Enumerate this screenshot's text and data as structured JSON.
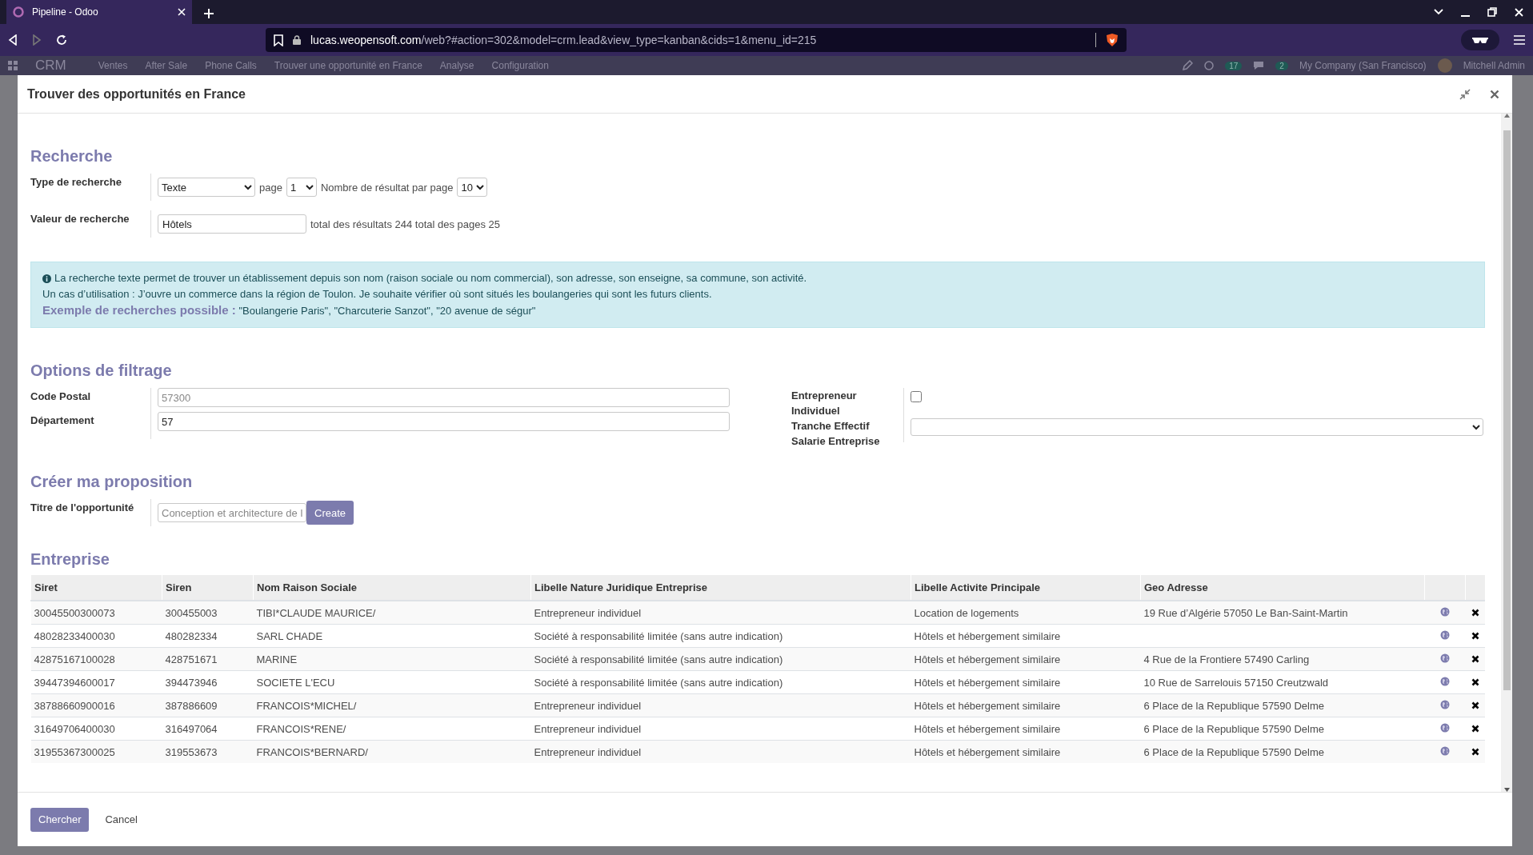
{
  "browser": {
    "tab_title": "Pipeline - Odoo",
    "url_host": "lucas.weopensoft.com",
    "url_path": "/web?#action=302&model=crm.lead&view_type=kanban&cids=1&menu_id=215"
  },
  "app_nav": {
    "app": "CRM",
    "menu": [
      "Ventes",
      "After Sale",
      "Phone Calls",
      "Trouver une opportunité en France",
      "Analyse",
      "Configuration"
    ],
    "activity_count": "17",
    "message_count": "2",
    "company": "My Company (San Francisco)",
    "user": "Mitchell Admin"
  },
  "dialog": {
    "title": "Trouver des opportunités en France",
    "search": {
      "heading": "Recherche",
      "type_label": "Type de recherche",
      "type_value": "Texte",
      "page_label": "page",
      "page_value": "1",
      "per_page_label": "Nombre de résultat par page",
      "per_page_value": "10",
      "value_label": "Valeur de recherche",
      "value": "Hôtels",
      "totals": "total des résultats 244 total des pages 25"
    },
    "info": {
      "line_1": "La recherche texte permet de trouver un établissement depuis son nom (raison sociale ou nom commercial), son adresse, son enseigne, sa commune, son activité.",
      "line_2": "Un cas d’utilisation : J’ouvre un commerce dans la région de Toulon. Je souhaite vérifier où sont situés les boulangeries qui sont les futurs clients.",
      "example": "**Exemple de recherches possible :** \"Boulangerie Paris\", \"Charcuterie Sanzot\", \"20 avenue de ségur\""
    },
    "filters": {
      "heading": "Options de filtrage",
      "postal_label": "Code Postal",
      "postal_placeholder": "57300",
      "department_label": "Département",
      "department_value": "57",
      "individual_label": "Entrepreneur Individuel",
      "individual_checked": false,
      "headcount_label": "Tranche Effectif Salarie Entreprise"
    },
    "proposal": {
      "heading": "Créer ma proposition",
      "title_label": "Titre de l'opportunité",
      "title_placeholder": "Conception et architecture de l",
      "create_button": "Create"
    },
    "companies": {
      "heading": "Entreprise",
      "columns": [
        "Siret",
        "Siren",
        "Nom Raison Sociale",
        "Libelle Nature Juridique Entreprise",
        "Libelle Activite Principale",
        "Geo Adresse"
      ],
      "rows": [
        {
          "siret": "30045500300073",
          "siren": "300455003",
          "name": "TIBI*CLAUDE MAURICE/",
          "legal_form": "Entrepreneur individuel",
          "activity": "Location de logements",
          "address": "19 Rue d’Algérie 57050 Le Ban-Saint-Martin"
        },
        {
          "siret": "48028233400030",
          "siren": "480282334",
          "name": "SARL CHADE",
          "legal_form": "Société à responsabilité limitée (sans autre indication)",
          "activity": "Hôtels et hébergement similaire"
        },
        {
          "siret": "42875167100028",
          "siren": "428751671",
          "name": "MARINE",
          "legal_form": "Société à responsabilité limitée (sans autre indication)",
          "activity": "Hôtels et hébergement similaire",
          "address": "4 Rue de la Frontiere 57490 Carling"
        },
        {
          "siret": "39447394600017",
          "siren": "394473946",
          "name": "SOCIETE L'ECU",
          "legal_form": "Société à responsabilité limitée (sans autre indication)",
          "activity": "Hôtels et hébergement similaire",
          "address": "10 Rue de Sarrelouis 57150 Creutzwald"
        },
        {
          "siret": "38788660900016",
          "siren": "387886609",
          "name": "FRANCOIS*MICHEL/",
          "legal_form": "Entrepreneur individuel",
          "activity": "Hôtels et hébergement similaire",
          "address": "6 Place de la Republique 57590 Delme"
        },
        {
          "siret": "31649706400030",
          "siren": "316497064",
          "name": "FRANCOIS*RENE/",
          "legal_form": "Entrepreneur individuel",
          "activity": "Hôtels et hébergement similaire",
          "address": "6 Place de la Republique 57590 Delme"
        },
        {
          "siret": "31955367300025",
          "siren": "319553673",
          "name": "FRANCOIS*BERNARD/",
          "legal_form": "Entrepreneur individuel",
          "activity": "Hôtels et hébergement similaire",
          "address": "6 Place de la Republique 57590 Delme"
        }
      ]
    },
    "footer": {
      "search_button": "Chercher",
      "cancel_button": "Cancel"
    }
  }
}
